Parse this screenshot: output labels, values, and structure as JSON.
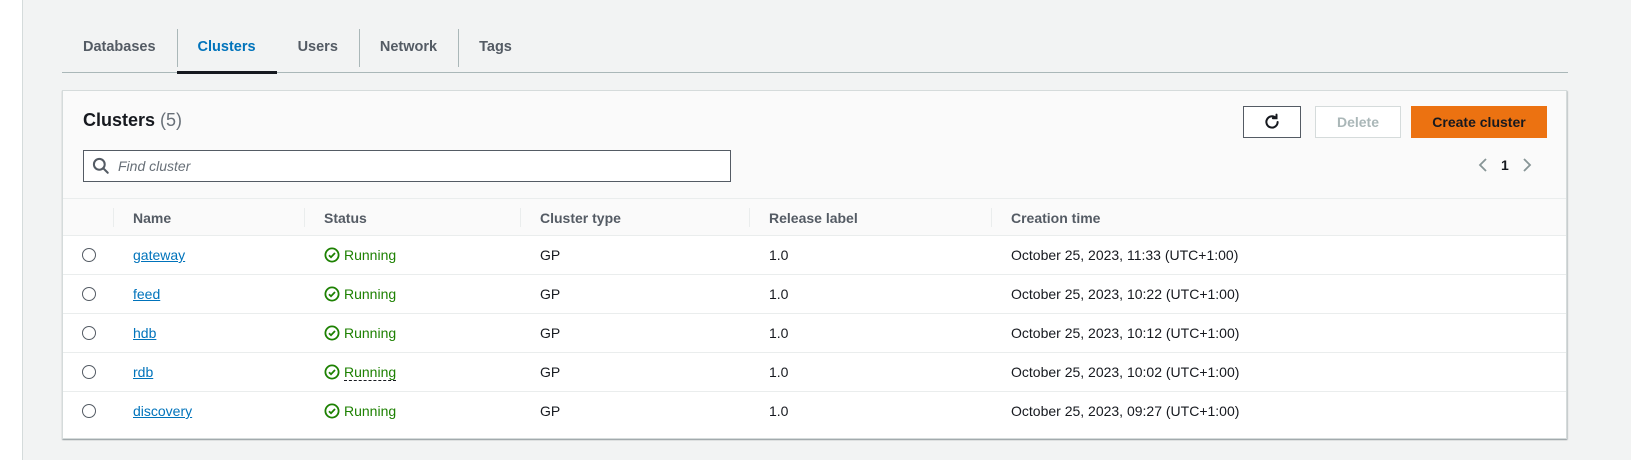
{
  "tabs": [
    {
      "label": "Databases",
      "active": false
    },
    {
      "label": "Clusters",
      "active": true
    },
    {
      "label": "Users",
      "active": false
    },
    {
      "label": "Network",
      "active": false
    },
    {
      "label": "Tags",
      "active": false
    }
  ],
  "panel": {
    "title": "Clusters",
    "count": "(5)",
    "delete_label": "Delete",
    "create_label": "Create cluster",
    "search_placeholder": "Find cluster",
    "page_number": "1"
  },
  "table": {
    "columns": [
      "Name",
      "Status",
      "Cluster type",
      "Release label",
      "Creation time"
    ],
    "rows": [
      {
        "name": "gateway",
        "status": "Running",
        "type": "GP",
        "release": "1.0",
        "created": "October 25, 2023, 11:33 (UTC+1:00)"
      },
      {
        "name": "feed",
        "status": "Running",
        "type": "GP",
        "release": "1.0",
        "created": "October 25, 2023, 10:22 (UTC+1:00)"
      },
      {
        "name": "hdb",
        "status": "Running",
        "type": "GP",
        "release": "1.0",
        "created": "October 25, 2023, 10:12 (UTC+1:00)"
      },
      {
        "name": "rdb",
        "status": "Running",
        "type": "GP",
        "release": "1.0",
        "created": "October 25, 2023, 10:02 (UTC+1:00)"
      },
      {
        "name": "discovery",
        "status": "Running",
        "type": "GP",
        "release": "1.0",
        "created": "October 25, 2023, 09:27 (UTC+1:00)"
      }
    ]
  },
  "colors": {
    "accent": "#0073bb",
    "primary_button": "#ec7211",
    "success": "#1d8102"
  },
  "icons": {
    "refresh": "refresh-icon",
    "search": "search-icon",
    "status": "check-circle-icon",
    "prev": "chevron-left-icon",
    "next": "chevron-right-icon"
  }
}
